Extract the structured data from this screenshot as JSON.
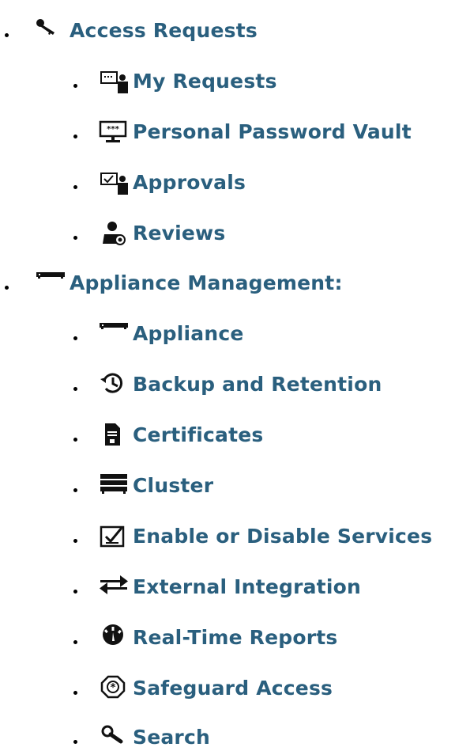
{
  "nav": {
    "access_requests": {
      "label": "Access Requests",
      "icon": "key-icon",
      "children": [
        {
          "label": "My Requests",
          "icon": "requests-icon"
        },
        {
          "label": "Personal Password Vault",
          "icon": "password-vault-icon"
        },
        {
          "label": "Approvals",
          "icon": "approvals-icon"
        },
        {
          "label": "Reviews",
          "icon": "reviews-icon"
        }
      ]
    },
    "appliance_management": {
      "label": "Appliance Management:",
      "icon": "appliance-icon",
      "children": [
        {
          "label": "Appliance",
          "icon": "appliance-icon"
        },
        {
          "label": "Backup and Retention",
          "icon": "history-icon"
        },
        {
          "label": "Certificates",
          "icon": "certificate-icon"
        },
        {
          "label": "Cluster",
          "icon": "cluster-icon"
        },
        {
          "label": "Enable or Disable Services",
          "icon": "checkbox-icon"
        },
        {
          "label": "External Integration",
          "icon": "exchange-arrows-icon"
        },
        {
          "label": "Real-Time Reports",
          "icon": "gauge-icon"
        },
        {
          "label": "Safeguard Access",
          "icon": "safeguard-badge-icon"
        },
        {
          "label": "Search",
          "icon": "magnifier-icon"
        }
      ]
    }
  }
}
